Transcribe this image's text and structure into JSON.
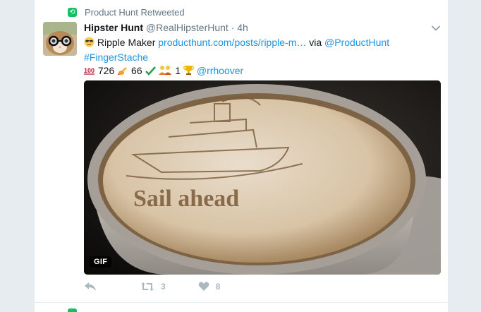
{
  "context": {
    "label": "Product Hunt Retweeted",
    "badge_color": "#17bf63"
  },
  "tweet": {
    "fullname": "Hipster Hunt",
    "handle": "@RealHipsterHunt",
    "separator": "·",
    "time": "4h",
    "line1_text": "Ripple Maker",
    "line1_link": "producthunt.com/posts/ripple-m…",
    "line1_via": "via",
    "line1_mention": "@ProductHunt",
    "hashtag": "#FingerStache",
    "stat_100": "726",
    "stat_writing": "66",
    "stat_trophy": "1",
    "credit_mention": "@rrhoover",
    "media_caption": "Sail ahead",
    "media_badge": "GIF"
  },
  "actions": {
    "retweet_count": "3",
    "like_count": "8"
  },
  "icons": [
    "retweet-badge-icon",
    "chevron-down-icon",
    "sunglasses-emoji-icon",
    "hundred-emoji-icon",
    "writing-hand-emoji-icon",
    "check-mark-emoji-icon",
    "people-emoji-icon",
    "trophy-emoji-icon",
    "reply-icon",
    "retweet-icon",
    "heart-icon"
  ],
  "colors": {
    "link": "#1b95e0",
    "muted": "#657786",
    "action": "#aab8c2"
  }
}
